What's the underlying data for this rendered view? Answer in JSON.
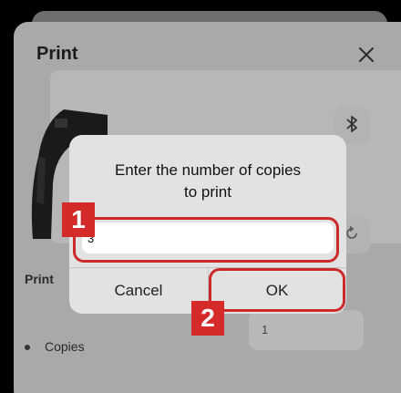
{
  "sheet": {
    "title": "Print",
    "section_label": "Print",
    "copies_label": "Copies",
    "copies_value": "1"
  },
  "dialog": {
    "title_line1": "Enter the number of copies",
    "title_line2": "to print",
    "input_value": "3",
    "cancel_label": "Cancel",
    "ok_label": "OK"
  },
  "annotations": {
    "step1": "1",
    "step2": "2"
  },
  "colors": {
    "highlight": "#cc2a2a",
    "badge": "#d42a2a"
  },
  "icons": [
    "close-icon",
    "bluetooth-icon",
    "refresh-icon",
    "device-image"
  ]
}
